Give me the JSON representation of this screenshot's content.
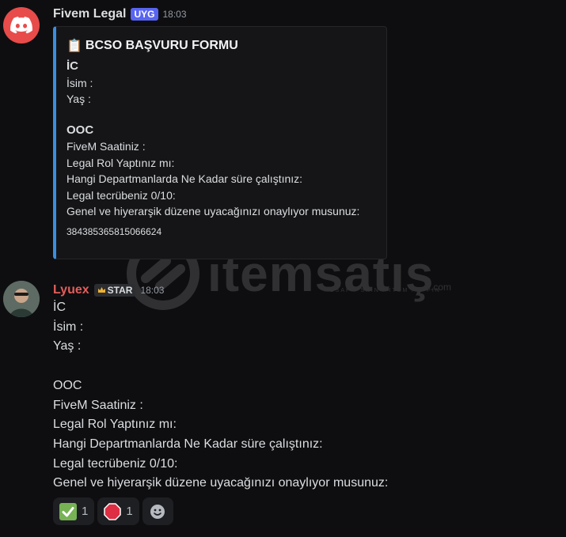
{
  "bot_message": {
    "author": "Fivem Legal",
    "badge": "UYG",
    "time": "18:03",
    "embed": {
      "title_emoji": "📋",
      "title": "BCSO BAŞVURU FORMU",
      "ic_heading": "İC",
      "ic_lines": [
        "İsim :",
        "Yaş :"
      ],
      "ooc_heading": "OOC",
      "ooc_lines": [
        "FiveM Saatiniz :",
        "Legal Rol Yaptınız mı:",
        "Hangi Departmanlarda Ne Kadar süre çalıştınız:",
        "Legal tecrübeniz 0/10:",
        "Genel ve hiyerarşik düzene uyacağınızı onaylıyor musunuz:"
      ],
      "footer_id": "384385365815066624",
      "accent_color": "#3a8ee0"
    }
  },
  "user_message": {
    "author": "Lyuex",
    "role_badge": "STAR",
    "time": "18:03",
    "lines": [
      "İC",
      "İsim :",
      "Yaş :",
      "",
      "OOC",
      "FiveM Saatiniz :",
      "Legal Rol Yaptınız mı:",
      "Hangi Departmanlarda Ne Kadar süre çalıştınız:",
      "Legal tecrübeniz 0/10:",
      "Genel ve hiyerarşik düzene uyacağınızı onaylıyor musunuz:"
    ],
    "reactions": [
      {
        "icon": "check-mark-icon",
        "count": "1"
      },
      {
        "icon": "stop-sign-icon",
        "count": "1"
      }
    ],
    "add_reaction_icon": "smiley-icon"
  },
  "watermark": {
    "text": "itemsatış",
    "tagline": "HESAP / SKIN / ITEM / E-PIN",
    "suffix": ".com"
  },
  "colors": {
    "background": "#0e0e10",
    "bot_avatar": "#e74c4a",
    "bot_badge": "#5865f2",
    "user_name": "#e35d5b"
  }
}
